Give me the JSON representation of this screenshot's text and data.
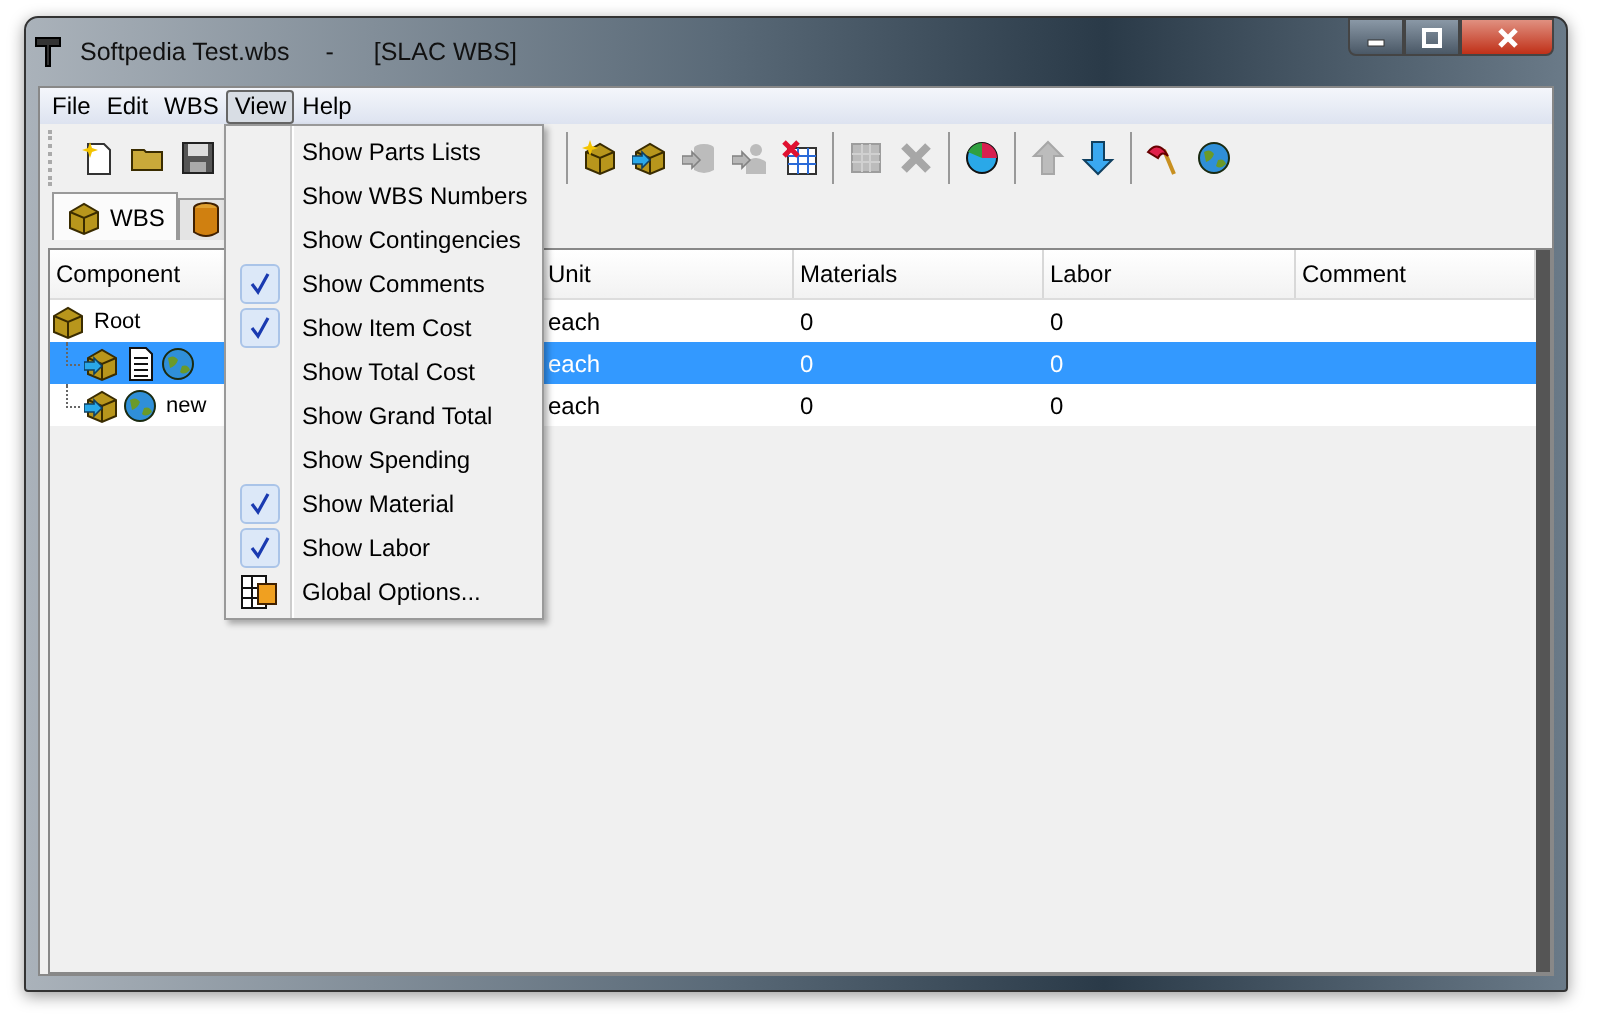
{
  "window": {
    "title": "Softpedia Test.wbs",
    "separator": "-",
    "subtitle": "[SLAC WBS]"
  },
  "menubar": [
    {
      "label": "File",
      "selected": false
    },
    {
      "label": "Edit",
      "selected": false
    },
    {
      "label": "WBS",
      "selected": false
    },
    {
      "label": "View",
      "selected": true
    },
    {
      "label": "Help",
      "selected": false
    }
  ],
  "toolbar": {
    "groups": [
      [
        {
          "disabled": false
        },
        {
          "disabled": false
        },
        {
          "disabled": false
        }
      ],
      [
        {
          "disabled": false
        },
        {
          "disabled": false
        },
        {
          "disabled": true
        },
        {
          "disabled": true
        },
        {
          "disabled": false
        }
      ],
      [
        {
          "disabled": true
        },
        {
          "disabled": true
        }
      ],
      [
        {
          "disabled": false
        }
      ],
      [
        {
          "disabled": true
        },
        {
          "disabled": false
        }
      ],
      [
        {
          "disabled": false
        },
        {
          "disabled": false
        }
      ]
    ]
  },
  "tabs": [
    {
      "label": "WBS",
      "selected": true
    },
    {
      "selected": false
    }
  ],
  "table": {
    "columns": [
      "Component",
      "Unit",
      "Materials",
      "Labor",
      "Comment"
    ],
    "rows": [
      {
        "kind": "root",
        "component": "Root",
        "unit": "each",
        "materials": "0",
        "labor": "0",
        "selected": false,
        "children": [
          {
            "kind": "document",
            "unit": "each",
            "materials": "0",
            "labor": "0",
            "selected": true
          },
          {
            "kind": "item",
            "component": "new",
            "unit": "each",
            "materials": "0",
            "labor": "0",
            "selected": false
          }
        ]
      }
    ]
  },
  "view_menu": [
    {
      "kind": "toggle",
      "label": "Show Parts Lists",
      "checked": false
    },
    {
      "kind": "toggle",
      "label": "Show WBS Numbers",
      "checked": false
    },
    {
      "kind": "toggle",
      "label": "Show Contingencies",
      "checked": false
    },
    {
      "kind": "toggle",
      "label": "Show Comments",
      "checked": true
    },
    {
      "kind": "toggle",
      "label": "Show Item Cost",
      "checked": true
    },
    {
      "kind": "toggle",
      "label": "Show Total Cost",
      "checked": false
    },
    {
      "kind": "toggle",
      "label": "Show Grand Total",
      "checked": false
    },
    {
      "kind": "toggle",
      "label": "Show Spending",
      "checked": false
    },
    {
      "kind": "toggle",
      "label": "Show Material",
      "checked": true
    },
    {
      "kind": "toggle",
      "label": "Show Labor",
      "checked": true
    },
    {
      "kind": "command",
      "label": "Global Options..."
    }
  ]
}
